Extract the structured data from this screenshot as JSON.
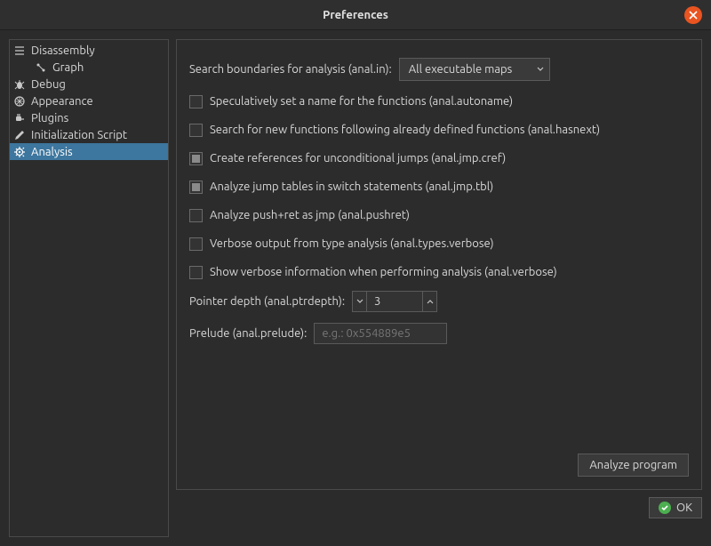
{
  "window": {
    "title": "Preferences"
  },
  "sidebar": {
    "items": [
      {
        "label": "Disassembly",
        "icon": "disassembly"
      },
      {
        "label": "Graph",
        "icon": "graph",
        "child": true
      },
      {
        "label": "Debug",
        "icon": "debug"
      },
      {
        "label": "Appearance",
        "icon": "appearance"
      },
      {
        "label": "Plugins",
        "icon": "plugins"
      },
      {
        "label": "Initialization Script",
        "icon": "edit"
      },
      {
        "label": "Analysis",
        "icon": "gear",
        "selected": true
      }
    ]
  },
  "analysis": {
    "search_boundaries_label": "Search boundaries for analysis (anal.in):",
    "search_boundaries_value": "All executable maps",
    "checks": [
      {
        "label": "Speculatively set a name for the functions (anal.autoname)",
        "checked": false
      },
      {
        "label": "Search for new functions following already defined functions (anal.hasnext)",
        "checked": false
      },
      {
        "label": "Create references for unconditional jumps (anal.jmp.cref)",
        "checked": true
      },
      {
        "label": "Analyze jump tables in switch statements (anal.jmp.tbl)",
        "checked": true
      },
      {
        "label": "Analyze push+ret as jmp (anal.pushret)",
        "checked": false
      },
      {
        "label": "Verbose output from type analysis (anal.types.verbose)",
        "checked": false
      },
      {
        "label": "Show verbose information when performing analysis (anal.verbose)",
        "checked": false
      }
    ],
    "ptrdepth_label": "Pointer depth (anal.ptrdepth):",
    "ptrdepth_value": "3",
    "prelude_label": "Prelude (anal.prelude):",
    "prelude_placeholder": "e.g.: 0x554889e5",
    "analyze_button": "Analyze program"
  },
  "footer": {
    "ok": "OK"
  }
}
